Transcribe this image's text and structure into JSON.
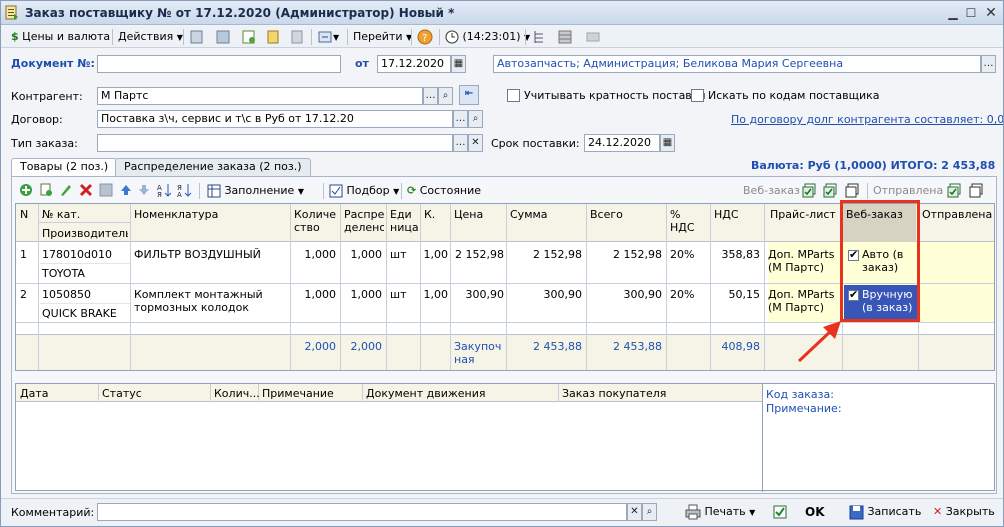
{
  "window": {
    "title": "Заказ поставщику №  от 17.12.2020 (Администратор) Новый *"
  },
  "toolbar": {
    "prices_currency": "Цены и валюта",
    "actions": "Действия",
    "goto": "Перейти",
    "time": "(14:23:01)"
  },
  "header": {
    "doc_label": "Документ №:",
    "doc_number": "",
    "from_label": "от",
    "date": "17.12.2020",
    "responsible": "Автозапчасть; Администрация; Беликова Мария Сергеевна",
    "counterparty_label": "Контрагент:",
    "counterparty": "М Партс",
    "contract_label": "Договор:",
    "contract": "Поставка з\\ч, сервис и т\\с в Руб от 17.12.20",
    "order_type_label": "Тип заказа:",
    "order_type": "",
    "multiplicity_label": "Учитывать кратность поставки",
    "supplier_codes_label": "Искать по кодам поставщика",
    "debt_link": "По договору долг контрагента составляет: 0,00 Руб",
    "delivery_label": "Срок поставки:",
    "delivery_date": "24.12.2020",
    "currency_total": "Валюта: Руб (1,0000) ИТОГО: 2 453,88"
  },
  "tabs": [
    {
      "label": "Товары (2 поз.)"
    },
    {
      "label": "Распределение заказа (2 поз.)"
    }
  ],
  "grid_toolbar": {
    "fill": "Заполнение",
    "selection": "Подбор",
    "state": "Состояние",
    "web_order": "Веб-заказ",
    "sent": "Отправлена"
  },
  "columns": {
    "n": "N",
    "catalog": "№ кат.",
    "producer": "Производитель",
    "nomenclature": "Номенклатура",
    "qty": "Количе ство",
    "distributed": "Распре делено",
    "unit": "Еди ница",
    "k": "К.",
    "price": "Цена",
    "sum": "Сумма",
    "total": "Всего",
    "vat_pct": "% НДС",
    "vat": "НДС",
    "price_list": "Прайс-лист",
    "web_order": "Веб-заказ",
    "sent": "Отправлена"
  },
  "rows": [
    {
      "n": "1",
      "catalog": "178010d010",
      "producer": "TOYOTA",
      "nomenclature": "ФИЛЬТР ВОЗДУШНЫЙ",
      "qty": "1,000",
      "distributed": "1,000",
      "unit": "шт",
      "k": "1,00",
      "price": "2 152,98",
      "sum": "2 152,98",
      "total": "2 152,98",
      "vat_pct": "20%",
      "vat": "358,83",
      "price_list": "Доп. MParts (М Партс)",
      "web_order": "Авто (в заказ)",
      "sent": ""
    },
    {
      "n": "2",
      "catalog": "1050850",
      "producer": "QUICK BRAKE",
      "nomenclature": "Комплект монтажный тормозных колодок Toyota ...",
      "qty": "1,000",
      "distributed": "1,000",
      "unit": "шт",
      "k": "1,00",
      "price": "300,90",
      "sum": "300,90",
      "total": "300,90",
      "vat_pct": "20%",
      "vat": "50,15",
      "price_list": "Доп. MParts (М Партс)",
      "web_order": "Вручную (в заказ)",
      "sent": ""
    }
  ],
  "totals": {
    "qty": "2,000",
    "distributed": "2,000",
    "price_label": "Закупочная",
    "sum": "2 453,88",
    "total": "2 453,88",
    "vat": "408,98"
  },
  "lower_columns": {
    "date": "Дата",
    "status": "Статус",
    "qty": "Колич...",
    "note": "Примечание",
    "movement_doc": "Документ движения",
    "buyer_order": "Заказ покупателя"
  },
  "lower_side": {
    "order_code": "Код заказа:",
    "note": "Примечание:"
  },
  "footer": {
    "comment_label": "Комментарий:",
    "comment": "",
    "print": "Печать",
    "ok": "OK",
    "save": "Записать",
    "close": "Закрыть"
  },
  "colors": {
    "highlight": "#e8321e",
    "selected_cell": "#3856b8",
    "yellow_row": "#ffffd8"
  }
}
